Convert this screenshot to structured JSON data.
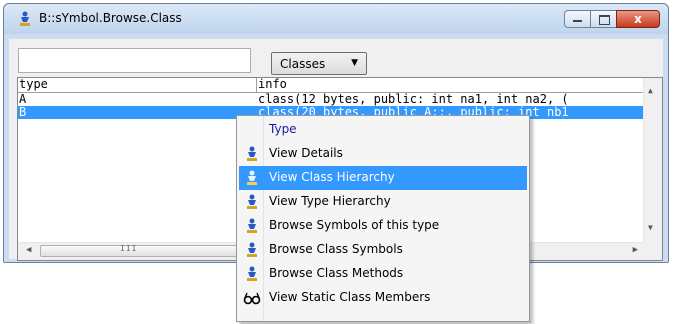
{
  "window": {
    "title": "B::sYmbol.Browse.Class",
    "close_glyph": "x"
  },
  "toolbar": {
    "search_value": "",
    "filter_selected": "Classes"
  },
  "list": {
    "columns": [
      "type",
      "info"
    ],
    "rows": [
      {
        "type": "A",
        "info": "class(12 bytes, public: int na1, int na2, ("
      },
      {
        "type": "B",
        "info": "class(20 bytes, public A::, public: int nb1"
      }
    ],
    "selected_row": 1,
    "hscroll_grip": "III"
  },
  "context_menu": {
    "header": "Type",
    "items": [
      {
        "label": "View Details",
        "icon": "person-icon"
      },
      {
        "label": "View Class Hierarchy",
        "icon": "person-icon",
        "highlighted": true
      },
      {
        "label": "View Type Hierarchy",
        "icon": "person-icon"
      },
      {
        "label": "Browse Symbols of this type",
        "icon": "person-icon"
      },
      {
        "label": "Browse Class Symbols",
        "icon": "person-icon"
      },
      {
        "label": "Browse Class Methods",
        "icon": "person-icon"
      },
      {
        "label": "View Static Class Members",
        "icon": "glasses-icon"
      }
    ]
  },
  "colors": {
    "selection": "#3399ff",
    "titlebar": "#c9dcf0",
    "close_button": "#c7381b"
  }
}
